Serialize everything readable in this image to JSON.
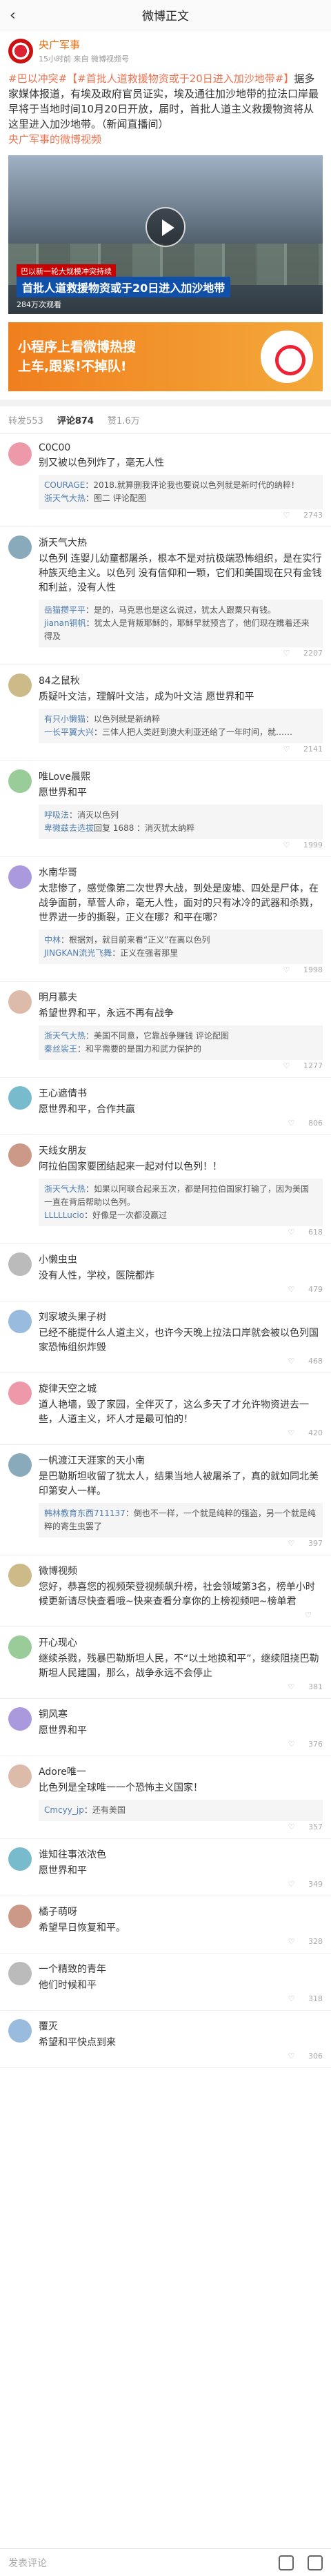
{
  "topbar": {
    "title": "微博正文",
    "back": "‹"
  },
  "author": {
    "name": "央广军事",
    "sub": "15小时前  来自 微博视频号"
  },
  "post": {
    "tag": "#巴以冲突#",
    "topic": "【#首批人道救援物资或于20日进入加沙地带#】",
    "body": "据多家媒体报道，有埃及政府官员证实，埃及通往加沙地带的拉法口岸最早将于当地时间10月20日开放，届时，首批人道主义救援物资将从这里进入加沙地带。（新闻直播间）",
    "source": "央广军事的微博视频"
  },
  "video": {
    "tag": "巴以新一轮大规模冲突持续",
    "caption": "首批人道救援物资或于20日进入加沙地带",
    "count": "284万次观看"
  },
  "banner": {
    "line1": "小程序上看微博热搜",
    "line2": "上车,跟紧!不掉队!"
  },
  "tabs": [
    "转发553",
    "评论874",
    "赞1.6万"
  ],
  "comments": [
    {
      "name": "C0C00",
      "text": "别又被以色列炸了，毫无人性",
      "replies": [
        {
          "n": "COURAGE",
          "t": "：2018.就算删我评论我也要说以色列就是新时代的纳粹！"
        },
        {
          "n": "浙天气大热",
          "t": "：图二 评论配图"
        }
      ],
      "likes": "2743"
    },
    {
      "name": "浙天气大热",
      "text": "以色列 连婴儿幼童都屠杀，根本不是对抗极端恐怖组织，是在实行种族灭绝主义。以色列 没有信仰和一颗，它们和美国现在只有金钱和利益，没有人性",
      "replies": [
        {
          "n": "岳猫攒平平",
          "t": "：是的，马克思也是这么说过，犹太人跟粟只有钱。"
        },
        {
          "n": "jianan铜帆",
          "t": "：犹太人是背叛耶稣的，耶稣早就预言了，他们现在瞧着还来得及"
        }
      ],
      "likes": "2207"
    },
    {
      "name": "84之鼠秋",
      "text": "质疑叶文洁，理解叶文洁，成为叶文洁 愿世界和平",
      "replies": [
        {
          "n": "有只小懒猫",
          "t": "：以色列就是新纳粹"
        },
        {
          "n": "一长平翼大兴",
          "t": "：三体人把人类赶到澳大利亚还给了一年时间，就……"
        }
      ],
      "likes": "2141"
    },
    {
      "name": "唯Love晨熙",
      "text": "愿世界和平",
      "replies": [
        {
          "n": "呼吸法",
          "t": "：消灭以色列"
        },
        {
          "n": "卑微兹去选拔",
          "t": "回复 1688 ：消灭犹太纳粹"
        }
      ],
      "likes": "1999"
    },
    {
      "name": "水南华哥",
      "text": "太悲惨了，感觉像第二次世界大战，到处是废墟、四处是尸体，在战争面前，草菅人命，毫无人性，面对的只有冰冷的武器和杀戮，世界进一步的撕裂，正义在哪？和平在哪？",
      "replies": [
        {
          "n": "中林",
          "t": "：根据刘，就目前来看“正义”在离以色列"
        },
        {
          "n": "JINGKAN流光飞舞",
          "t": "：正义在强者那里"
        }
      ],
      "likes": "1998"
    },
    {
      "name": "明月慕夫",
      "text": "希望世界和平，永远不再有战争",
      "replies": [
        {
          "n": "浙天气大热",
          "t": "：美国不同意，它靠战争赚钱 评论配图"
        },
        {
          "n": "秦丝裟王",
          "t": "：和平需要的是国力和武力保护的"
        }
      ],
      "likes": "1277"
    },
    {
      "name": "王心遮倩书",
      "text": "愿世界和平，合作共赢",
      "replies": [],
      "likes": "806"
    },
    {
      "name": "天线女朋友",
      "text": "阿拉伯国家要团结起来一起对付以色列！！",
      "replies": [
        {
          "n": "浙天气大热",
          "t": "：如果以阿联合起来五次，都是阿拉伯国家打输了，因为美国一直在背后帮助以色列。"
        },
        {
          "n": "LLLLLucio",
          "t": "：好像是一次都没赢过"
        }
      ],
      "likes": "618"
    },
    {
      "name": "小懒虫虫",
      "text": "没有人性，学校，医院都炸",
      "replies": [],
      "likes": "479"
    },
    {
      "name": "刘家坡头果子树",
      "text": "已经不能提什么人道主义，也许今天晚上拉法口岸就会被以色列国家恐怖组织炸毁",
      "replies": [],
      "likes": "468"
    },
    {
      "name": "旋律天空之城",
      "text": "道人艳墙，毁了家园，全伴灭了，这么多天了才允许物资进去一些，人道主义，坏人才是最可怕的！",
      "replies": [],
      "likes": "420"
    },
    {
      "name": "一帆渡江天涯家的天小南",
      "text": "是巴勒斯坦收留了犹太人，结果当地人被屠杀了，真的就如同北美印第安人一样。",
      "replies": [
        {
          "n": "韩林教育东西711137",
          "t": "：倒也不一样，一个就是纯粹的强盗，另一个就是纯粹的寄生虫罢了"
        }
      ],
      "likes": "397"
    },
    {
      "name": "微博视频",
      "text": "您好，恭喜您的视频荣登视频飙升榜，社会领域第3名，榜单小时候更新请尽快查看哦~快来查看分享你的上榜视频吧~榜单君",
      "replies": [],
      "likes": ""
    },
    {
      "name": "开心现心",
      "text": "继续杀戮，残暴巴勒斯坦人民，不“以土地换和平”，继续阻挠巴勒斯坦人民建国，那么，战争永远不会停止",
      "replies": [],
      "likes": "381"
    },
    {
      "name": "铜风寒",
      "text": "愿世界和平",
      "replies": [],
      "likes": "376"
    },
    {
      "name": "Adore唯一",
      "text": "比色列是全球唯一一个恐怖主义国家！",
      "replies": [
        {
          "n": "Cmcyy_jp",
          "t": "：还有美国"
        }
      ],
      "likes": "357"
    },
    {
      "name": "谁知往事浓浓色",
      "text": "愿世界和平",
      "replies": [],
      "likes": "349"
    },
    {
      "name": "橘子萌呀",
      "text": "希望早日恢复和平。",
      "replies": [],
      "likes": "328"
    },
    {
      "name": "一个精致的青年",
      "text": "他们时候和平",
      "replies": [],
      "likes": "318"
    },
    {
      "name": "覆灭",
      "text": "希望和平快点到来",
      "replies": [],
      "likes": "306"
    }
  ],
  "bottom": {
    "placeholder": "发表评论"
  },
  "colors": {
    "accent": "#eb7350",
    "link": "#507daf",
    "banner": "#f07f1e"
  }
}
